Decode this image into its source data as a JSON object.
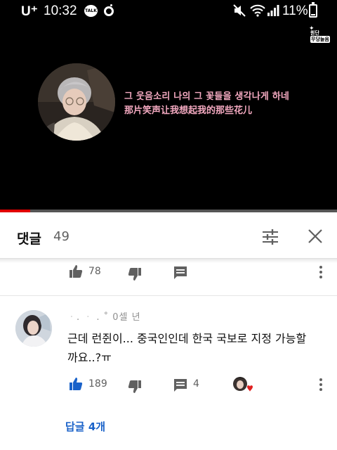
{
  "status_bar": {
    "carrier": "U⁺",
    "time": "10:32",
    "kakaotalk_badge": "TALK",
    "battery_percent": "11%",
    "battery_level": 0.11,
    "icons": [
      "kakaotalk-icon",
      "ring-icon",
      "mute-icon",
      "wifi-icon",
      "signal-icon",
      "battery-icon"
    ]
  },
  "video": {
    "channel_logo_line1": "원단",
    "channel_logo_line2": "무당늘음",
    "lyric_korean": "그 웃음소리 나의 그 꽃들을 생각나게 하네",
    "lyric_chinese": "那片笑声让我想起我的那些花儿",
    "progress": 0.09,
    "lyric_color": "#f3a9c0",
    "progress_color": "#e00000"
  },
  "comments_panel": {
    "title": "댓글",
    "count": "49",
    "icons": [
      "filter-icon",
      "close-icon"
    ]
  },
  "previous_comment": {
    "likes": "78"
  },
  "comment": {
    "author": "ᆞ. ᆞ . ˚ 0셀 년",
    "text": "근데 런쥔이... 중국인인데 한국 국보로 지정 가능할까요..?ㅠ",
    "likes": "189",
    "replies_count": "4",
    "view_replies": "답글 4개",
    "accent_color": "#1a62c9"
  }
}
